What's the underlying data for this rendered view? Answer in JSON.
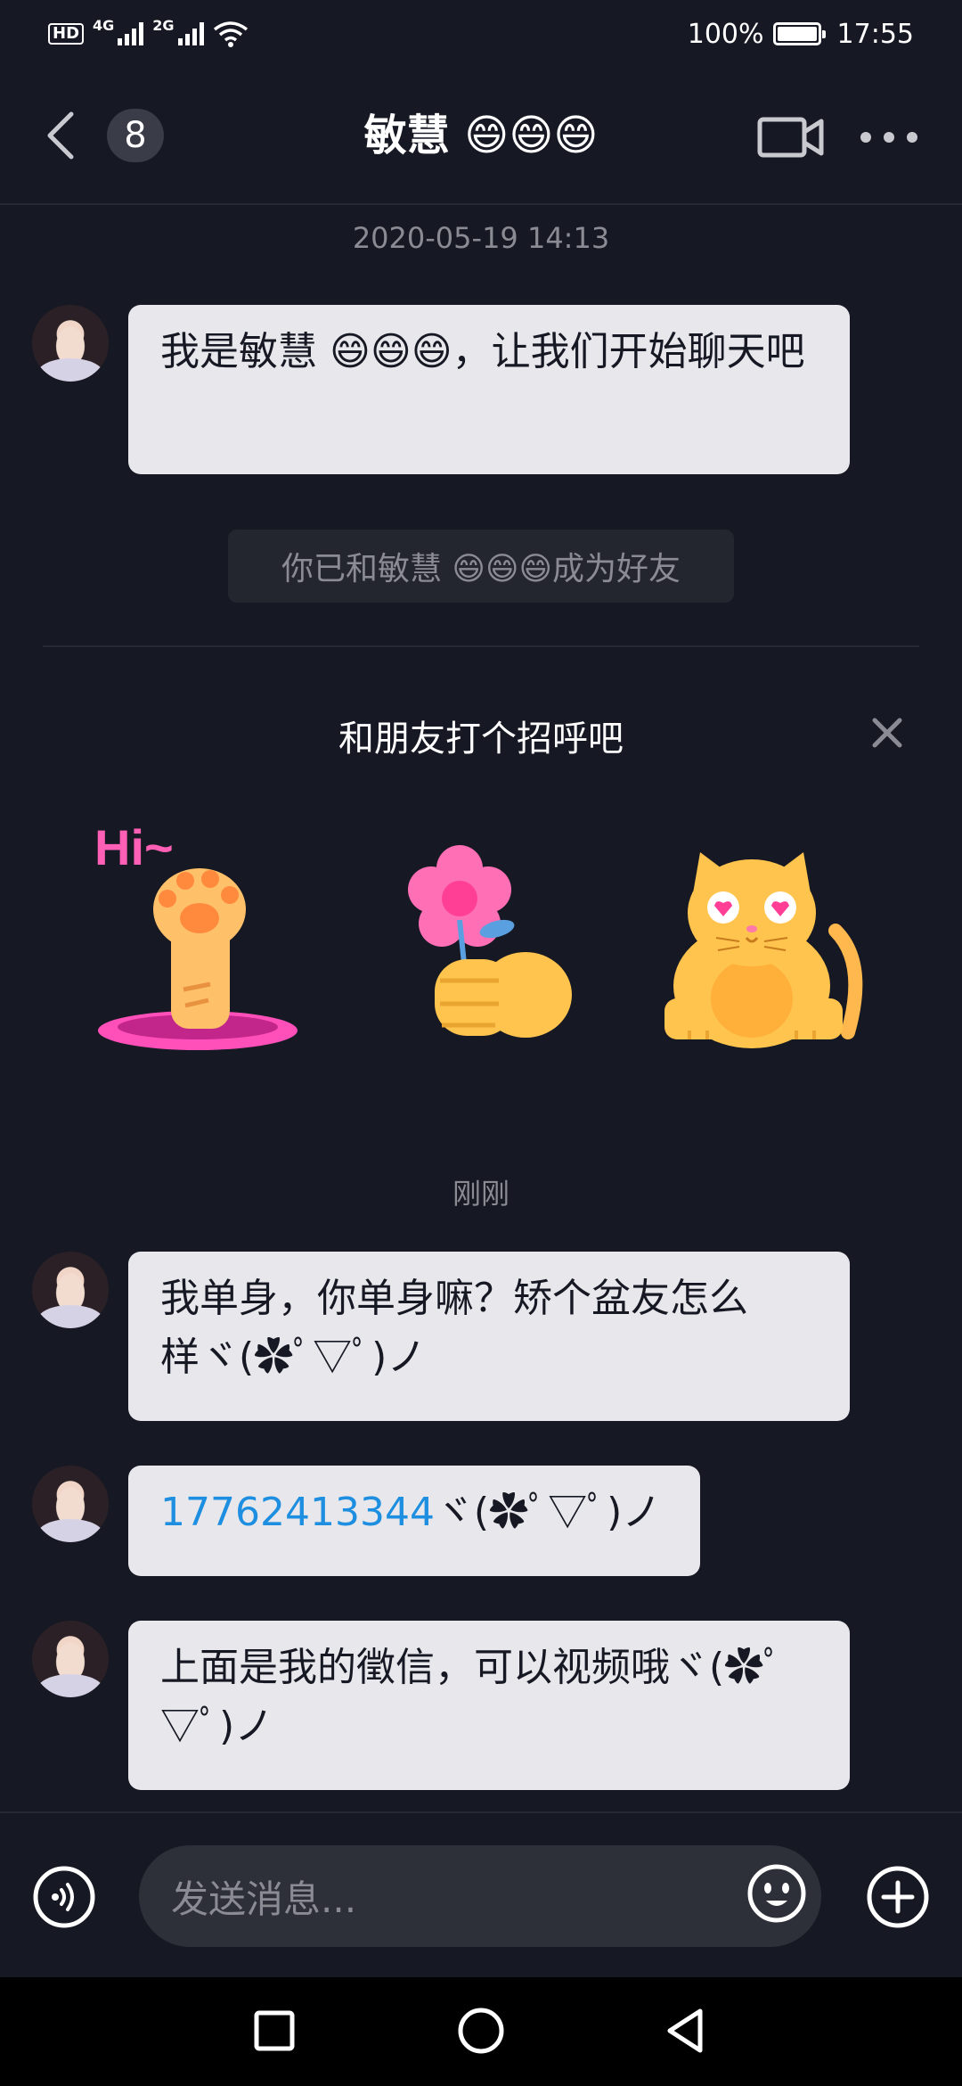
{
  "status_bar": {
    "hd": "HD",
    "net1": "4G",
    "net2": "2G",
    "battery": "100%",
    "time": "17:55"
  },
  "header": {
    "unread_count": "8",
    "title": "敏慧 😄😄😄"
  },
  "messages": {
    "timestamp1": "2020-05-19 14:13",
    "msg1": "我是敏慧 😄😄😄，让我们开始聊天吧",
    "system": "你已和敏慧 😄😄😄成为好友",
    "greeting_title": "和朋友打个招呼吧",
    "stickers": [
      {
        "name": "hi-paw-sticker",
        "text": "Hi~"
      },
      {
        "name": "flower-hand-sticker"
      },
      {
        "name": "heart-eyes-cat-sticker"
      }
    ],
    "timestamp2": "刚刚",
    "msg2": "我单身，你单身嘛？矫个盆友怎么样ヾ(✿ﾟ▽ﾟ)ノ",
    "msg3_link": "17762413344",
    "msg3_suffix": "ヾ(✿ﾟ▽ﾟ)ノ",
    "msg4": "上面是我的徵信，可以视频哦ヾ(✿ﾟ▽ﾟ)ノ"
  },
  "input": {
    "placeholder": "发送消息..."
  },
  "colors": {
    "background": "#161823",
    "bubble": "#e8e8ec",
    "link": "#1e8fe0",
    "muted_text": "#8a8b93"
  }
}
